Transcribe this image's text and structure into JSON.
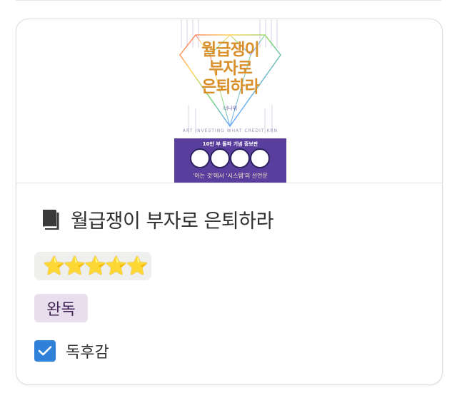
{
  "book": {
    "title": "월급쟁이 부자로 은퇴하라",
    "rating": "⭐⭐⭐⭐⭐",
    "rating_value": 5,
    "status": "완독",
    "review_label": "독후감",
    "review_checked": true,
    "cover": {
      "title_line1": "월급쟁이",
      "title_line2": "부자로",
      "title_line3": "은퇴하라",
      "author": "너나위",
      "tagline_small": "ART  INVESTING  WHAT  CREDIT  KRN",
      "band_top": "10만 부 돌파 기념 증보판",
      "band_bottom": "'아는 것'에서 '시스템'의 선언문",
      "band_color": "#5a3e9e"
    }
  }
}
